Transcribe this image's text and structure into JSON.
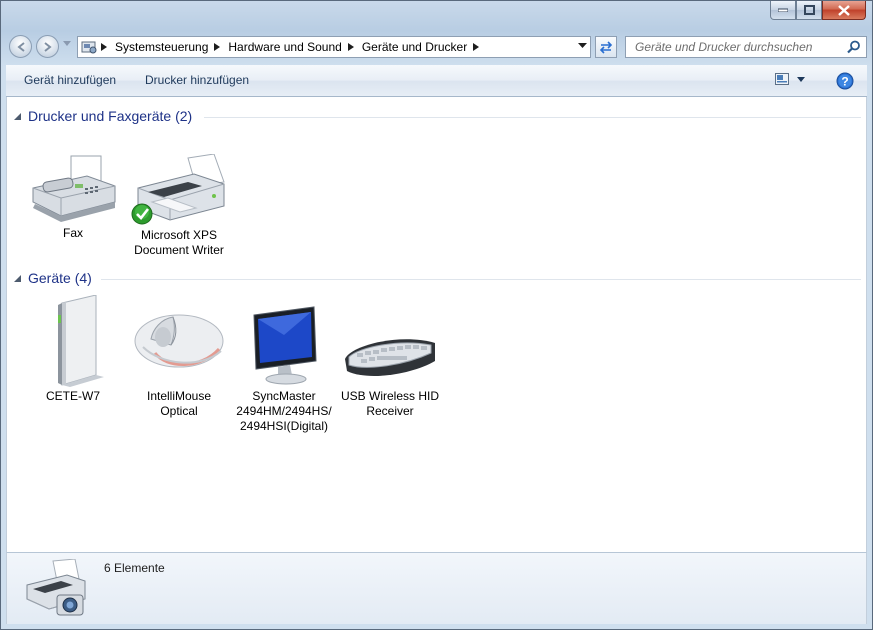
{
  "address": {
    "icon": "control-panel-icon",
    "crumbs": [
      "Systemsteuerung",
      "Hardware und Sound",
      "Geräte und Drucker"
    ]
  },
  "search": {
    "placeholder": "Geräte und Drucker durchsuchen"
  },
  "toolbar": {
    "add_device": "Gerät hinzufügen",
    "add_printer": "Drucker hinzufügen"
  },
  "groups": [
    {
      "title": "Drucker und Faxgeräte (2)",
      "items": [
        {
          "label": "Fax",
          "icon": "fax-icon"
        },
        {
          "label": "Microsoft XPS Document Writer",
          "icon": "printer-icon",
          "default": true
        }
      ]
    },
    {
      "title": "Geräte (4)",
      "items": [
        {
          "label": "CETE-W7",
          "icon": "computer-tower-icon"
        },
        {
          "label": "IntelliMouse Optical",
          "icon": "mouse-icon"
        },
        {
          "label": "SyncMaster 2494HM/2494HS/ 2494HSI(Digital)",
          "icon": "monitor-icon"
        },
        {
          "label": "USB Wireless HID Receiver",
          "icon": "keyboard-icon"
        }
      ]
    }
  ],
  "details": {
    "count": "6 Elemente",
    "icon": "devices-printers-icon"
  },
  "colors": {
    "group_title": "#1e3287",
    "command_text": "#1e395b",
    "accent": "#2a6fd1"
  }
}
